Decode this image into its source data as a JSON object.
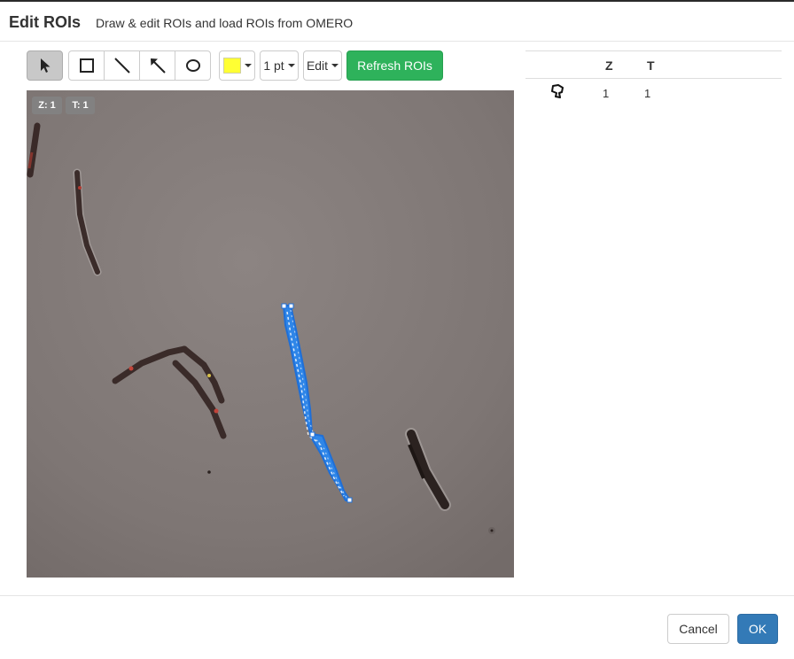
{
  "header": {
    "title": "Edit ROIs",
    "subtitle": "Draw & edit ROIs and load ROIs from OMERO"
  },
  "toolbar": {
    "tools": [
      {
        "name": "select",
        "icon": "pointer-icon",
        "active": true
      },
      {
        "name": "rectangle",
        "icon": "rectangle-icon",
        "active": false
      },
      {
        "name": "line",
        "icon": "line-icon",
        "active": false
      },
      {
        "name": "arrow",
        "icon": "arrow-icon",
        "active": false
      },
      {
        "name": "ellipse",
        "icon": "ellipse-icon",
        "active": false
      }
    ],
    "color": "#ffff33",
    "stroke_width": "1 pt",
    "edit_label": "Edit",
    "refresh_label": "Refresh ROIs",
    "refresh_color": "#2eb25b"
  },
  "viewer": {
    "z_badge": "Z: 1",
    "t_badge": "T: 1",
    "roi_color": "#2f86e8"
  },
  "roi_table": {
    "columns": [
      "Z",
      "T"
    ],
    "rows": [
      {
        "shape_icon": "polygon-icon",
        "z": "1",
        "t": "1"
      }
    ]
  },
  "footer": {
    "cancel_label": "Cancel",
    "ok_label": "OK",
    "ok_color": "#337ab7"
  }
}
